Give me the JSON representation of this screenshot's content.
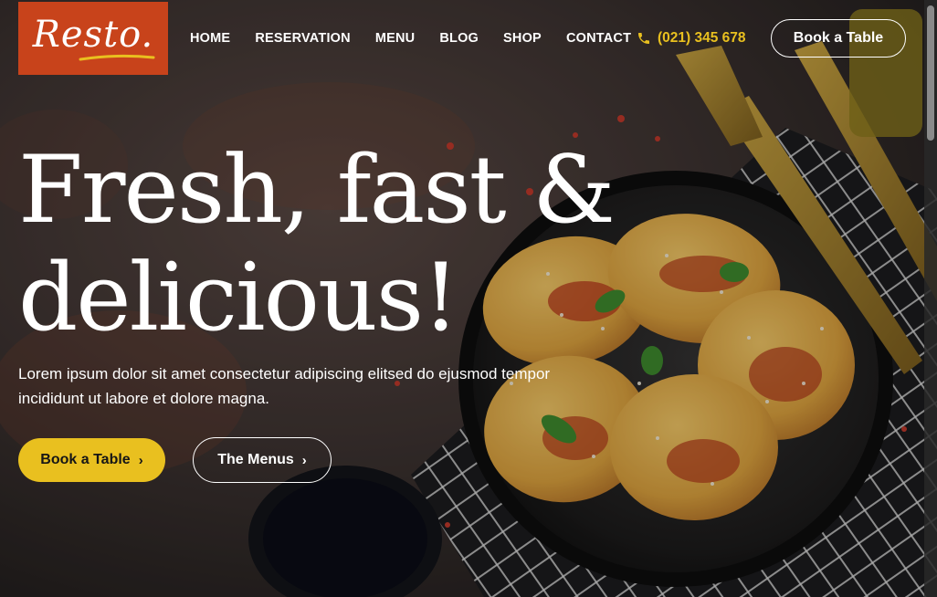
{
  "brand": {
    "name": "Resto."
  },
  "nav": {
    "items": [
      "HOME",
      "RESERVATION",
      "MENU",
      "BLOG",
      "SHOP",
      "CONTACT"
    ]
  },
  "header": {
    "phone": "(021) 345 678",
    "cta_label": "Book a Table"
  },
  "hero": {
    "headline_line1": "Fresh, fast &",
    "headline_line2": "delicious!",
    "subtext": "Lorem ipsum dolor sit amet consectetur adipiscing elitsed do ejusmod tempor incididunt ut labore et dolore magna.",
    "primary_button": "Book a Table",
    "secondary_button": "The Menus",
    "chevron": "›"
  },
  "colors": {
    "brand": "#c8431b",
    "accent": "#e9c01f",
    "background": "#2a2523",
    "text": "#ffffff"
  },
  "icons": {
    "phone": "phone-icon",
    "chevron": "chevron-right-icon"
  }
}
